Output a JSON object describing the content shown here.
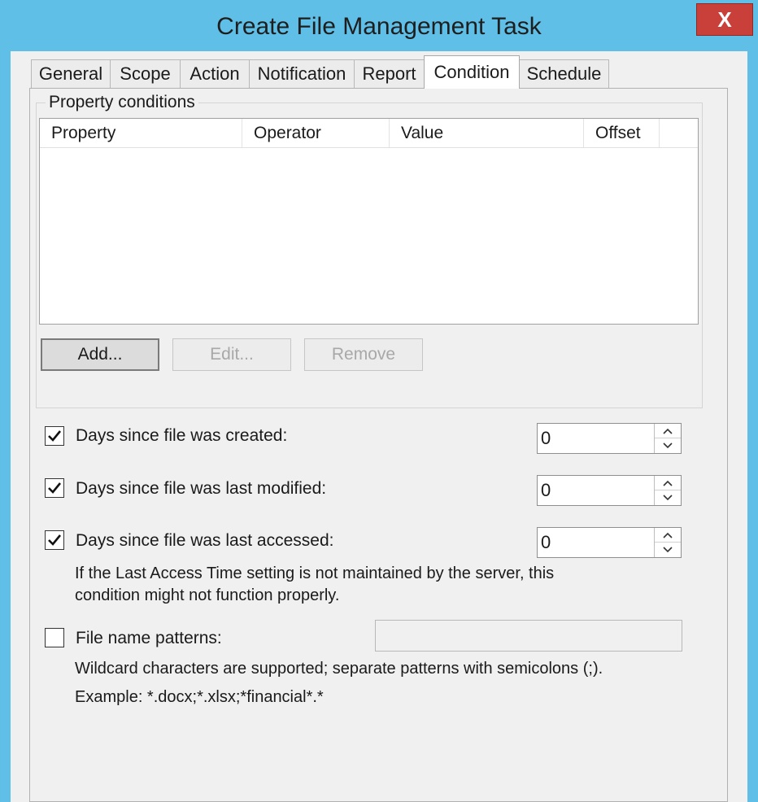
{
  "window": {
    "title": "Create File Management Task",
    "close_glyph": "X"
  },
  "tabs": [
    {
      "label": "General"
    },
    {
      "label": "Scope"
    },
    {
      "label": "Action"
    },
    {
      "label": "Notification"
    },
    {
      "label": "Report"
    },
    {
      "label": "Condition"
    },
    {
      "label": "Schedule"
    }
  ],
  "active_tab": "Condition",
  "property_conditions": {
    "group_label": "Property conditions",
    "columns": [
      "Property",
      "Operator",
      "Value",
      "Offset"
    ],
    "rows": [],
    "buttons": {
      "add": "Add...",
      "edit": "Edit...",
      "remove": "Remove"
    }
  },
  "conditions": {
    "created": {
      "label": "Days since file was created:",
      "checked": true,
      "value": "0"
    },
    "modified": {
      "label": "Days since file was last modified:",
      "checked": true,
      "value": "0"
    },
    "accessed": {
      "label": "Days since file was last accessed:",
      "checked": true,
      "value": "0"
    },
    "access_note_line1": "If the Last Access Time setting is not maintained by the server, this",
    "access_note_line2": "condition might not function properly.",
    "patterns": {
      "label": "File name patterns:",
      "checked": false,
      "value": ""
    },
    "wildcard_note": "Wildcard characters are supported; separate patterns with semicolons (;).",
    "example_note": "Example: *.docx;*.xlsx;*financial*.*"
  },
  "icons": {
    "checkmark": "check-icon",
    "spin_up": "chevron-up-icon",
    "spin_down": "chevron-down-icon"
  }
}
